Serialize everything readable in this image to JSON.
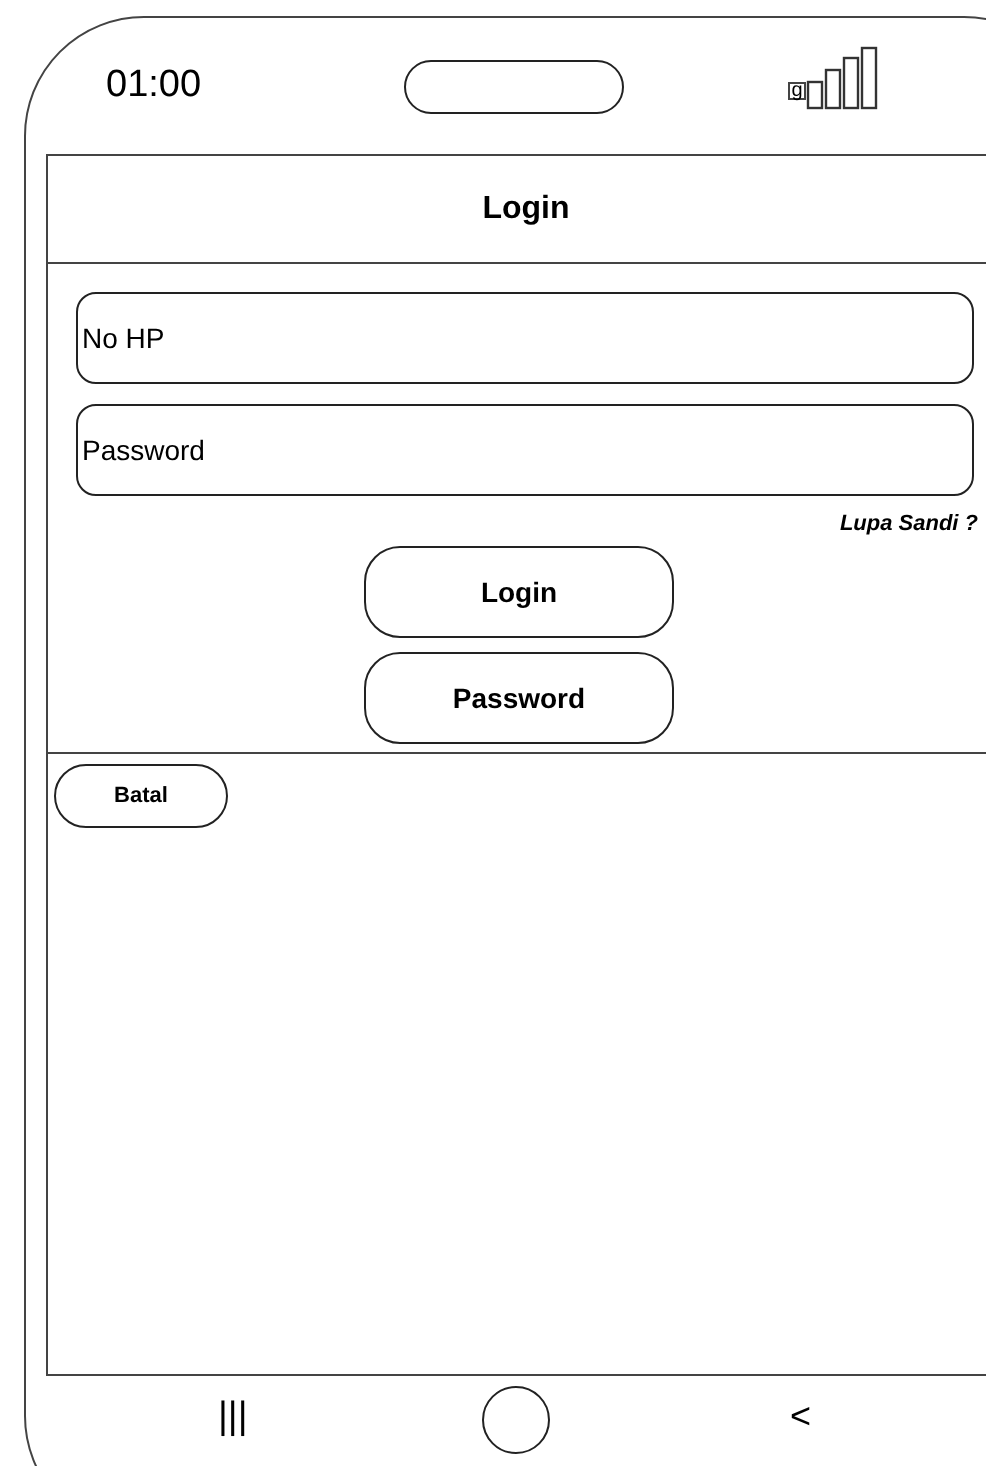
{
  "status_bar": {
    "time": "01:00",
    "signal_badge": "g"
  },
  "header": {
    "title": "Login"
  },
  "fields": [
    {
      "placeholder": "No HP"
    },
    {
      "placeholder": "Password"
    }
  ],
  "forgot_link": "Lupa Sandi ?",
  "buttons": [
    "Login",
    "Password"
  ],
  "cancel_button": "Batal",
  "nav_bar": {
    "recents": "|||",
    "back": "<"
  }
}
